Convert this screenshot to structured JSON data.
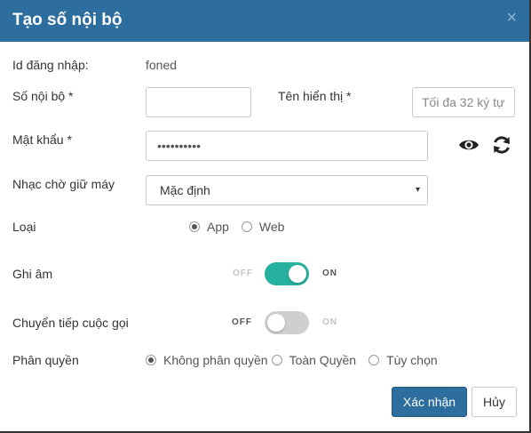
{
  "dialog": {
    "title": "Tạo số nội bộ",
    "close_symbol": "×"
  },
  "form": {
    "login_id": {
      "label": "Id đăng nhập:",
      "value": "foned"
    },
    "extension": {
      "label": "Số nội bộ *",
      "value": ""
    },
    "display_name": {
      "label": "Tên hiển thị *",
      "placeholder": "Tối đa 32 ký tự"
    },
    "password": {
      "label": "Mật khẩu *",
      "value": "••••••••••",
      "show_icon": "eye-icon",
      "refresh_icon": "refresh-icon"
    },
    "hold_music": {
      "label": "Nhạc chờ giữ máy",
      "selected": "Mặc định",
      "caret": "▾"
    },
    "type": {
      "label": "Loại",
      "options": [
        "App",
        "Web"
      ],
      "selected": "App"
    },
    "recording": {
      "label": "Ghi âm",
      "off_text": "OFF",
      "on_text": "ON",
      "enabled": true
    },
    "call_forward": {
      "label": "Chuyển tiếp cuộc gọi",
      "off_text": "OFF",
      "on_text": "ON",
      "enabled": false
    },
    "permission": {
      "label": "Phân quyền",
      "options": [
        "Không phân quyền",
        "Toàn Quyền",
        "Tùy chọn"
      ],
      "selected": "Không phân quyền"
    }
  },
  "actions": {
    "confirm_label": "Xác nhận",
    "cancel_label": "Hủy"
  },
  "colors": {
    "header": "#2d6e9e",
    "toggle_on": "#26b19e",
    "toggle_off": "#cfcfcf"
  }
}
